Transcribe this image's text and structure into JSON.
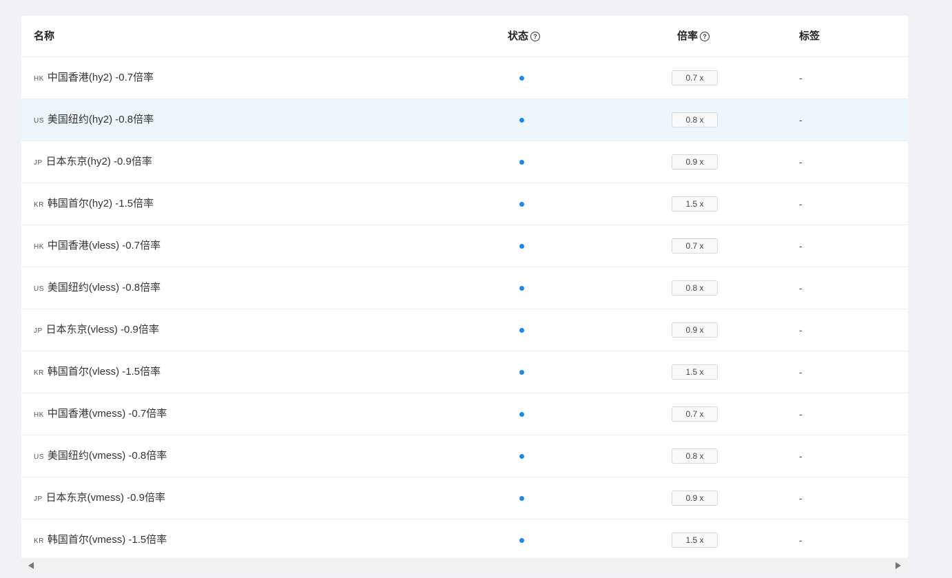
{
  "table": {
    "headers": {
      "name": "名称",
      "status": "状态",
      "rate": "倍率",
      "tags": "标签",
      "help_glyph": "?"
    },
    "rows": [
      {
        "flag": "HK",
        "name": "中国香港(hy2) -0.7倍率",
        "status": "online",
        "rate": "0.7 x",
        "tags": "-"
      },
      {
        "flag": "US",
        "name": "美国纽约(hy2) -0.8倍率",
        "status": "online",
        "rate": "0.8 x",
        "tags": "-"
      },
      {
        "flag": "JP",
        "name": "日本东京(hy2) -0.9倍率",
        "status": "online",
        "rate": "0.9 x",
        "tags": "-"
      },
      {
        "flag": "KR",
        "name": "韩国首尔(hy2) -1.5倍率",
        "status": "online",
        "rate": "1.5 x",
        "tags": "-"
      },
      {
        "flag": "HK",
        "name": "中国香港(vless) -0.7倍率",
        "status": "online",
        "rate": "0.7 x",
        "tags": "-"
      },
      {
        "flag": "US",
        "name": "美国纽约(vless) -0.8倍率",
        "status": "online",
        "rate": "0.8 x",
        "tags": "-"
      },
      {
        "flag": "JP",
        "name": "日本东京(vless) -0.9倍率",
        "status": "online",
        "rate": "0.9 x",
        "tags": "-"
      },
      {
        "flag": "KR",
        "name": "韩国首尔(vless) -1.5倍率",
        "status": "online",
        "rate": "1.5 x",
        "tags": "-"
      },
      {
        "flag": "HK",
        "name": "中国香港(vmess) -0.7倍率",
        "status": "online",
        "rate": "0.7 x",
        "tags": "-"
      },
      {
        "flag": "US",
        "name": "美国纽约(vmess) -0.8倍率",
        "status": "online",
        "rate": "0.8 x",
        "tags": "-"
      },
      {
        "flag": "JP",
        "name": "日本东京(vmess) -0.9倍率",
        "status": "online",
        "rate": "0.9 x",
        "tags": "-"
      },
      {
        "flag": "KR",
        "name": "韩国首尔(vmess) -1.5倍率",
        "status": "online",
        "rate": "1.5 x",
        "tags": "-"
      }
    ],
    "hovered_row": 1
  },
  "colors": {
    "status_online": "#1e88e5",
    "row_hover": "#edf6fd",
    "page_background": "#f0f2f5"
  },
  "icons": {
    "help": "question-circle-icon",
    "scroll_left": "triangle-left-icon",
    "scroll_right": "triangle-right-icon"
  }
}
